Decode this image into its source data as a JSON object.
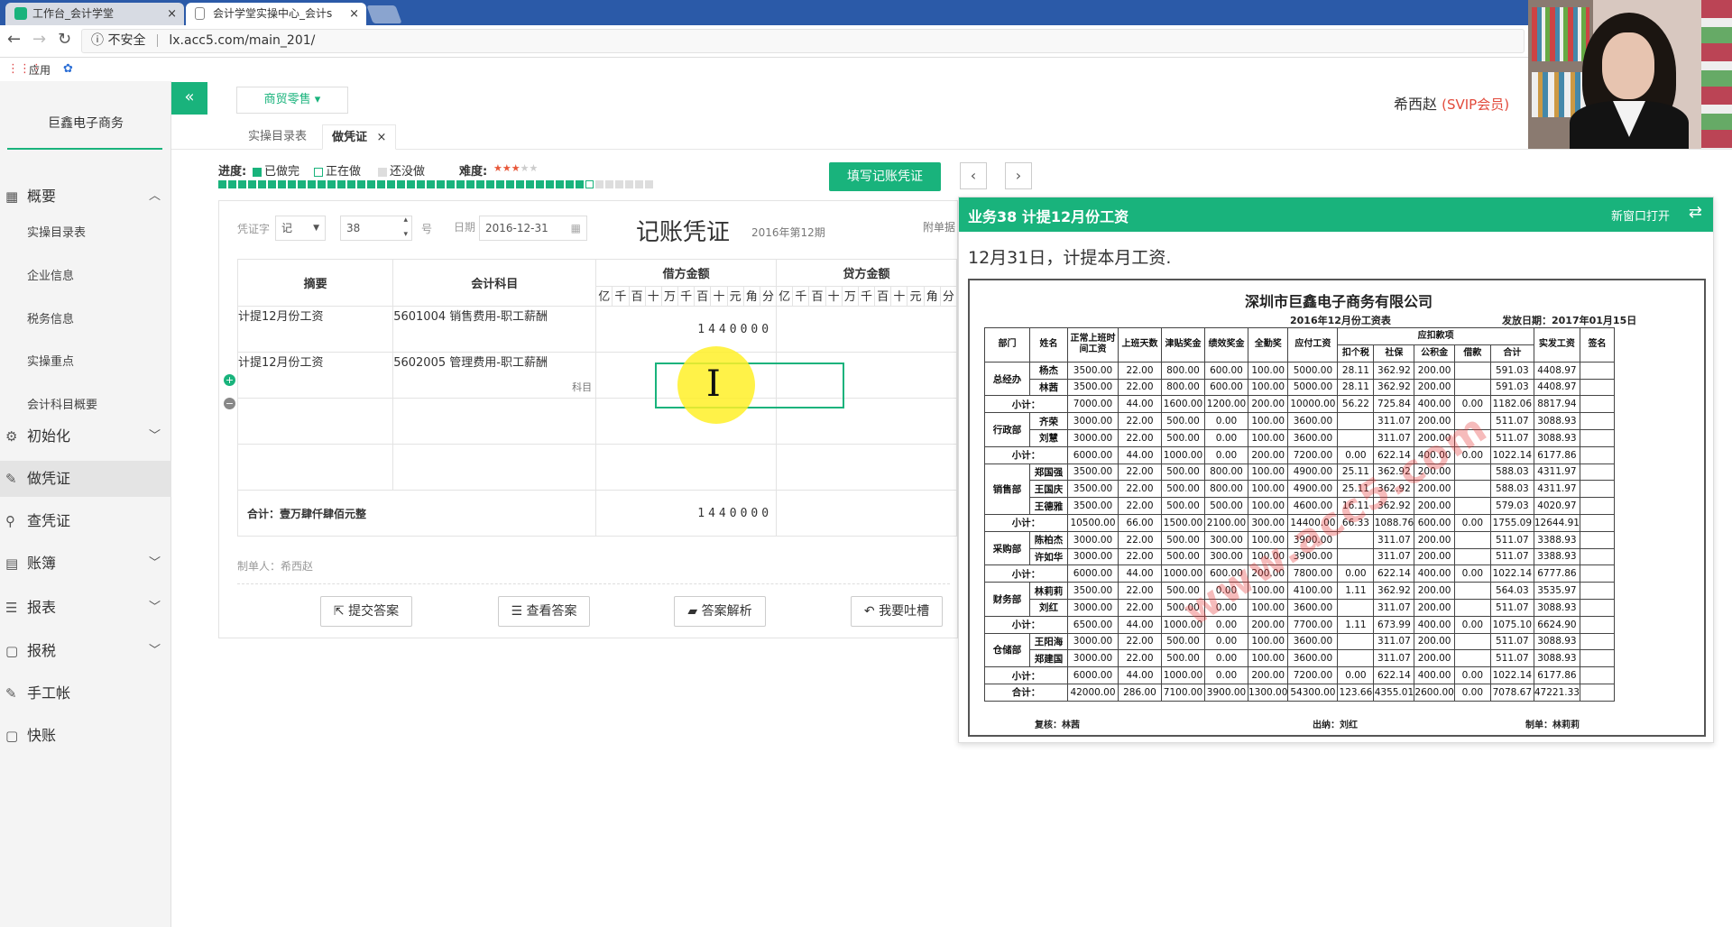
{
  "browser": {
    "tabs": [
      {
        "title": "工作台_会计学堂",
        "close": "×"
      },
      {
        "title": "会计学堂实操中心_会计s",
        "close": "×"
      }
    ],
    "security_label": "不安全",
    "url": "lx.acc5.com/main_201/",
    "bookmarks": [
      "应用"
    ]
  },
  "sidebar": {
    "company": "巨鑫电子商务",
    "menu": [
      {
        "label": "概要",
        "icon": "grid-icon",
        "expanded": true
      },
      {
        "label": "初始化",
        "icon": "gear-icon"
      },
      {
        "label": "做凭证",
        "icon": "pencil-icon",
        "active": true
      },
      {
        "label": "查凭证",
        "icon": "search-icon"
      },
      {
        "label": "账簿",
        "icon": "book-icon"
      },
      {
        "label": "报表",
        "icon": "list-icon"
      },
      {
        "label": "报税",
        "icon": "doc-icon"
      },
      {
        "label": "手工帐",
        "icon": "pencil-icon"
      },
      {
        "label": "快账",
        "icon": "doc-icon"
      }
    ],
    "submenu": [
      "实操目录表",
      "企业信息",
      "税务信息",
      "实操重点",
      "会计科目概要"
    ]
  },
  "header": {
    "collapse": "«",
    "industry": "商贸零售 ▾",
    "user_name": "希西赵",
    "user_badge": "(SVIP会员)"
  },
  "page_tabs": [
    {
      "label": "实操目录表"
    },
    {
      "label": "做凭证",
      "close": "×",
      "active": true
    }
  ],
  "progress": {
    "label": "进度:",
    "done": "已做完",
    "doing": "正在做",
    "todo": "还没做",
    "difficulty_label": "难度:",
    "difficulty_stars": 3,
    "difficulty_max": 5,
    "done_count": 37,
    "current_index": 38,
    "total": 44
  },
  "fill_button": "填写记账凭证",
  "nav": {
    "prev": "‹",
    "next": "›"
  },
  "voucher": {
    "word_label": "凭证字",
    "word_value": "记",
    "number_value": "38",
    "number_suffix": "号",
    "date_label": "日期",
    "date_value": "2016-12-31",
    "title": "记账凭证",
    "period": "2016年第12期",
    "attach_label": "附单据",
    "col_summary": "摘要",
    "col_account": "会计科目",
    "col_debit": "借方金额",
    "col_credit": "贷方金额",
    "digit_units": [
      "亿",
      "千",
      "百",
      "十",
      "万",
      "千",
      "百",
      "十",
      "元",
      "角",
      "分"
    ],
    "rows": [
      {
        "summary": "计提12月份工资",
        "account": "5601004 销售费用-职工薪酬",
        "debit": "1440000",
        "account_hint": ""
      },
      {
        "summary": "计提12月份工资",
        "account": "5602005 管理费用-职工薪酬",
        "debit": "",
        "account_hint": "科目"
      },
      {
        "summary": "",
        "account": "",
        "debit": ""
      },
      {
        "summary": "",
        "account": "",
        "debit": ""
      }
    ],
    "total_label": "合计：壹万肆仟肆佰元整",
    "total_debit": "1440000",
    "maker": "制单人：希西赵"
  },
  "actions": [
    {
      "label": "提交答案",
      "icon": "external-icon"
    },
    {
      "label": "查看答案",
      "icon": "database-icon"
    },
    {
      "label": "答案解析",
      "icon": "folder-icon"
    },
    {
      "label": "我要吐槽",
      "icon": "reply-icon"
    }
  ],
  "task": {
    "title": "业务38 计提12月份工资",
    "open_new": "新窗口打开",
    "swap": "⇄",
    "description": "12月31日，计提本月工资.",
    "sheet": {
      "company": "深圳市巨鑫电子商务有限公司",
      "subtitle": "2016年12月份工资表",
      "pay_date": "发放日期：2017年01月15日",
      "watermark": "www.acc5.com",
      "headers": [
        "部门",
        "姓名",
        "正常上班时间工资",
        "上班天数",
        "津贴奖金",
        "绩效奖金",
        "全勤奖",
        "应付工资",
        "应扣款项",
        "实发工资",
        "签名"
      ],
      "deduction_headers": [
        "扣个税",
        "社保",
        "公积金",
        "借款",
        "合计"
      ],
      "rows": [
        [
          "总经办",
          "杨杰",
          "3500.00",
          "22.00",
          "800.00",
          "600.00",
          "100.00",
          "5000.00",
          "28.11",
          "362.92",
          "200.00",
          "",
          "591.03",
          "4408.97",
          ""
        ],
        [
          "",
          "林茜",
          "3500.00",
          "22.00",
          "800.00",
          "600.00",
          "100.00",
          "5000.00",
          "28.11",
          "362.92",
          "200.00",
          "",
          "591.03",
          "4408.97",
          ""
        ],
        [
          "小计：",
          "",
          "7000.00",
          "44.00",
          "1600.00",
          "1200.00",
          "200.00",
          "10000.00",
          "56.22",
          "725.84",
          "400.00",
          "0.00",
          "1182.06",
          "8817.94",
          ""
        ],
        [
          "行政部",
          "齐荣",
          "3000.00",
          "22.00",
          "500.00",
          "0.00",
          "100.00",
          "3600.00",
          "",
          "311.07",
          "200.00",
          "",
          "511.07",
          "3088.93",
          ""
        ],
        [
          "",
          "刘慧",
          "3000.00",
          "22.00",
          "500.00",
          "0.00",
          "100.00",
          "3600.00",
          "",
          "311.07",
          "200.00",
          "",
          "511.07",
          "3088.93",
          ""
        ],
        [
          "小计：",
          "",
          "6000.00",
          "44.00",
          "1000.00",
          "0.00",
          "200.00",
          "7200.00",
          "0.00",
          "622.14",
          "400.00",
          "0.00",
          "1022.14",
          "6177.86",
          ""
        ],
        [
          "销售部",
          "郑国强",
          "3500.00",
          "22.00",
          "500.00",
          "800.00",
          "100.00",
          "4900.00",
          "25.11",
          "362.92",
          "200.00",
          "",
          "588.03",
          "4311.97",
          ""
        ],
        [
          "",
          "王国庆",
          "3500.00",
          "22.00",
          "500.00",
          "800.00",
          "100.00",
          "4900.00",
          "25.11",
          "362.92",
          "200.00",
          "",
          "588.03",
          "4311.97",
          ""
        ],
        [
          "",
          "王德雅",
          "3500.00",
          "22.00",
          "500.00",
          "500.00",
          "100.00",
          "4600.00",
          "16.11",
          "362.92",
          "200.00",
          "",
          "579.03",
          "4020.97",
          ""
        ],
        [
          "小计：",
          "",
          "10500.00",
          "66.00",
          "1500.00",
          "2100.00",
          "300.00",
          "14400.00",
          "66.33",
          "1088.76",
          "600.00",
          "0.00",
          "1755.09",
          "12644.91",
          ""
        ],
        [
          "采购部",
          "陈柏杰",
          "3000.00",
          "22.00",
          "500.00",
          "300.00",
          "100.00",
          "3900.00",
          "",
          "311.07",
          "200.00",
          "",
          "511.07",
          "3388.93",
          ""
        ],
        [
          "",
          "许如华",
          "3000.00",
          "22.00",
          "500.00",
          "300.00",
          "100.00",
          "3900.00",
          "",
          "311.07",
          "200.00",
          "",
          "511.07",
          "3388.93",
          ""
        ],
        [
          "小计：",
          "",
          "6000.00",
          "44.00",
          "1000.00",
          "600.00",
          "200.00",
          "7800.00",
          "0.00",
          "622.14",
          "400.00",
          "0.00",
          "1022.14",
          "6777.86",
          ""
        ],
        [
          "财务部",
          "林莉莉",
          "3500.00",
          "22.00",
          "500.00",
          "0.00",
          "100.00",
          "4100.00",
          "1.11",
          "362.92",
          "200.00",
          "",
          "564.03",
          "3535.97",
          ""
        ],
        [
          "",
          "刘红",
          "3000.00",
          "22.00",
          "500.00",
          "0.00",
          "100.00",
          "3600.00",
          "",
          "311.07",
          "200.00",
          "",
          "511.07",
          "3088.93",
          ""
        ],
        [
          "小计：",
          "",
          "6500.00",
          "44.00",
          "1000.00",
          "0.00",
          "200.00",
          "7700.00",
          "1.11",
          "673.99",
          "400.00",
          "0.00",
          "1075.10",
          "6624.90",
          ""
        ],
        [
          "仓储部",
          "王阳海",
          "3000.00",
          "22.00",
          "500.00",
          "0.00",
          "100.00",
          "3600.00",
          "",
          "311.07",
          "200.00",
          "",
          "511.07",
          "3088.93",
          ""
        ],
        [
          "",
          "郑建国",
          "3000.00",
          "22.00",
          "500.00",
          "0.00",
          "100.00",
          "3600.00",
          "",
          "311.07",
          "200.00",
          "",
          "511.07",
          "3088.93",
          ""
        ],
        [
          "小计：",
          "",
          "6000.00",
          "44.00",
          "1000.00",
          "0.00",
          "200.00",
          "7200.00",
          "0.00",
          "622.14",
          "400.00",
          "0.00",
          "1022.14",
          "6177.86",
          ""
        ],
        [
          "合计：",
          "",
          "42000.00",
          "286.00",
          "7100.00",
          "3900.00",
          "1300.00",
          "54300.00",
          "123.66",
          "4355.01",
          "2600.00",
          "0.00",
          "7078.67",
          "47221.33",
          ""
        ]
      ],
      "footer": [
        "复核：林茜",
        "出纳：刘红",
        "制单：林莉莉"
      ]
    }
  },
  "colors": {
    "accent": "#19b37c",
    "chrome": "#2b5aa8",
    "vip": "#e24a3b",
    "highlight": "#fff028"
  }
}
